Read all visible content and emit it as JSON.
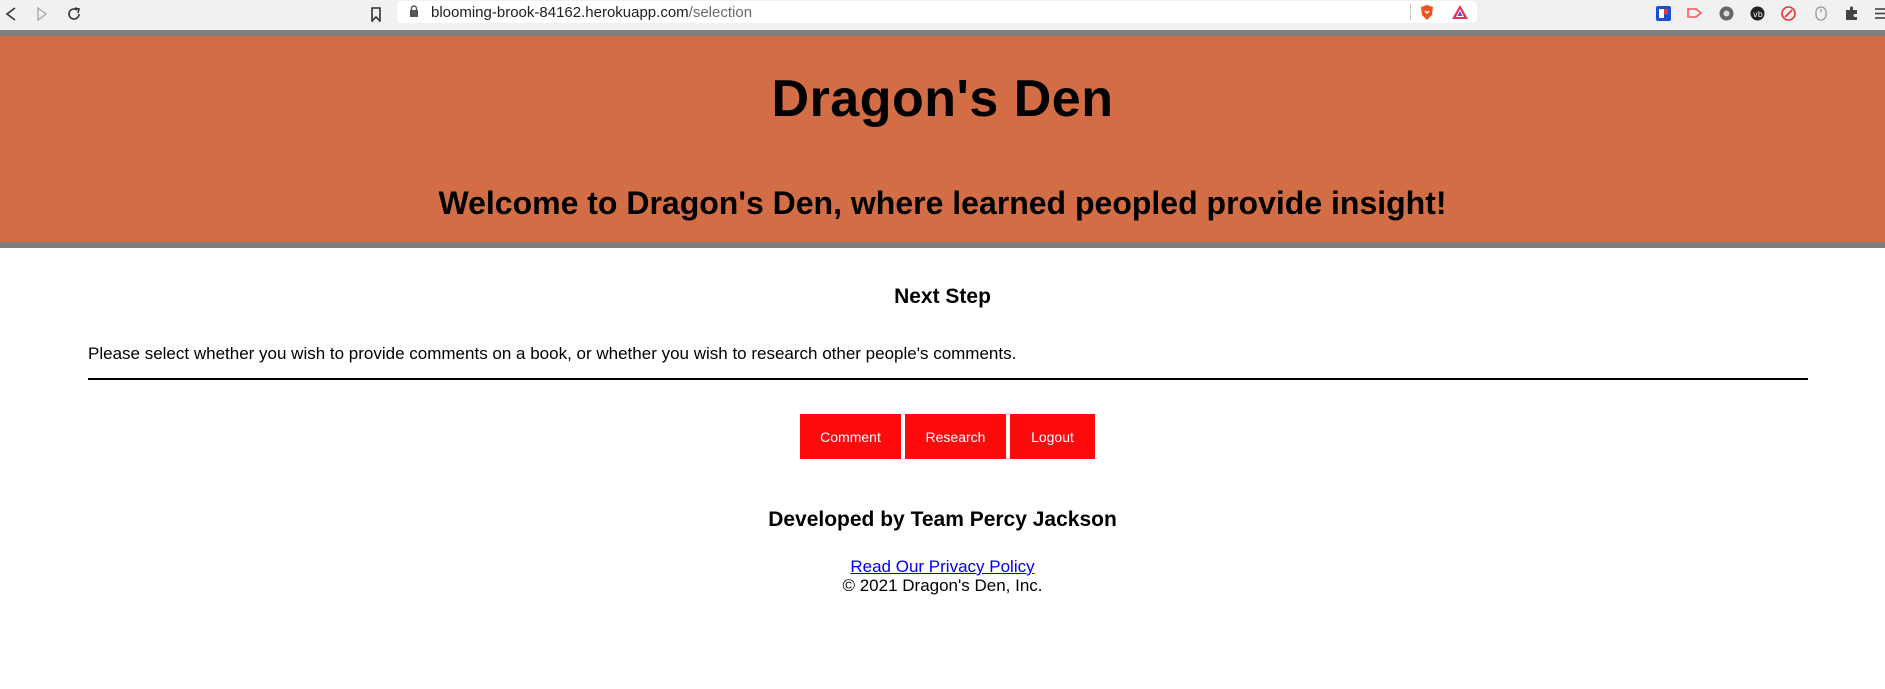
{
  "browser": {
    "url_host": "blooming-brook-84162.herokuapp.com",
    "url_path": "/selection",
    "icons": [
      "back-icon",
      "forward-icon",
      "reload-icon",
      "bookmark-icon",
      "lock-icon",
      "brave-shield-icon",
      "brave-rewards-icon",
      "extension-1-icon",
      "extension-2-icon",
      "extension-3-icon",
      "extension-4-icon",
      "extension-5-icon",
      "extension-6-icon",
      "extensions-puzzle-icon",
      "menu-icon"
    ]
  },
  "header": {
    "title": "Dragon's Den",
    "tagline": "Welcome to Dragon's Den, where learned peopled provide insight!",
    "background": "#d26d46",
    "border_color": "#7f7f7f"
  },
  "main": {
    "heading": "Next Step",
    "instruction": "Please select whether you wish to provide comments on a book, or whether you wish to research other people's comments.",
    "buttons": {
      "comment": "Comment",
      "research": "Research",
      "logout": "Logout"
    },
    "button_color": "#fd0a0c"
  },
  "footer": {
    "developed_by": "Developed by Team Percy Jackson",
    "privacy_link": "Read Our Privacy Policy",
    "copyright": "© 2021 Dragon's Den, Inc."
  }
}
